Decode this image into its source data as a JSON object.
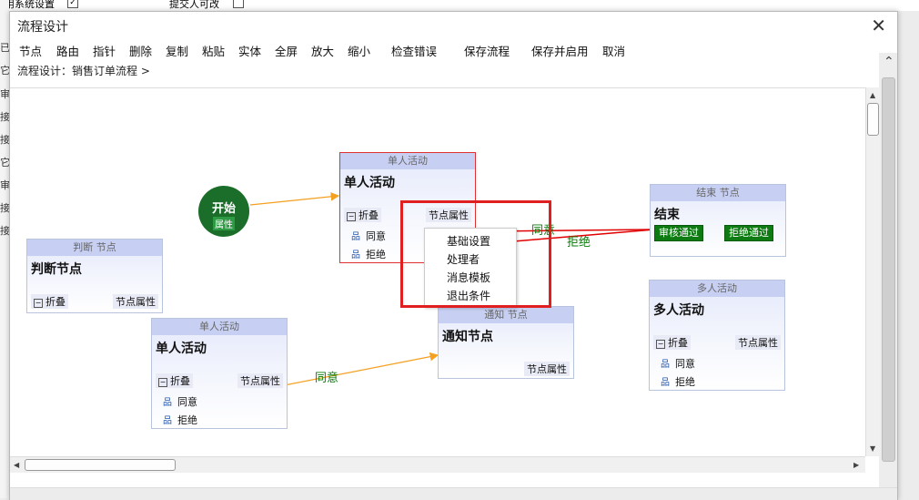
{
  "background": {
    "top_left": "采用系统设置",
    "top_right": "提交人可改",
    "left_labels": [
      "已",
      "它",
      "审",
      "接",
      "接",
      "它",
      "审",
      "接",
      "接"
    ]
  },
  "dialog": {
    "title": "流程设计",
    "close": "✕",
    "toolbar": [
      "节点",
      "路由",
      "指针",
      "删除",
      "复制",
      "粘贴",
      "实体",
      "全屏",
      "放大",
      "缩小",
      "检查错误",
      "保存流程",
      "保存并启用",
      "取消"
    ],
    "breadcrumb": "流程设计：销售订单流程 >"
  },
  "flow": {
    "start": {
      "label": "开始",
      "attr": "属性"
    },
    "common": {
      "fold": "折叠",
      "props": "节点属性",
      "agree": "同意",
      "reject": "拒绝"
    },
    "nodes": [
      {
        "type": "单人活动",
        "name": "单人活动"
      },
      {
        "type": "判断 节点",
        "name": "判断节点"
      },
      {
        "type": "单人活动",
        "name": "单人活动"
      },
      {
        "type": "通知 节点",
        "name": "通知节点"
      },
      {
        "type": "结束 节点",
        "name": "结束"
      },
      {
        "type": "多人活动",
        "name": "多人活动"
      }
    ],
    "end_buttons": [
      "审核通过",
      "拒绝通过"
    ],
    "context_menu": [
      "基础设置",
      "处理者",
      "消息模板",
      "退出条件"
    ],
    "edge_labels": [
      "同意",
      "拒绝",
      "同意"
    ]
  },
  "colors": {
    "highlight": "#e02020",
    "start": "#1b6e2a",
    "edge_agree": "#f4a020",
    "edge_reject": "#e00000",
    "label_green": "#0a7d0a"
  }
}
